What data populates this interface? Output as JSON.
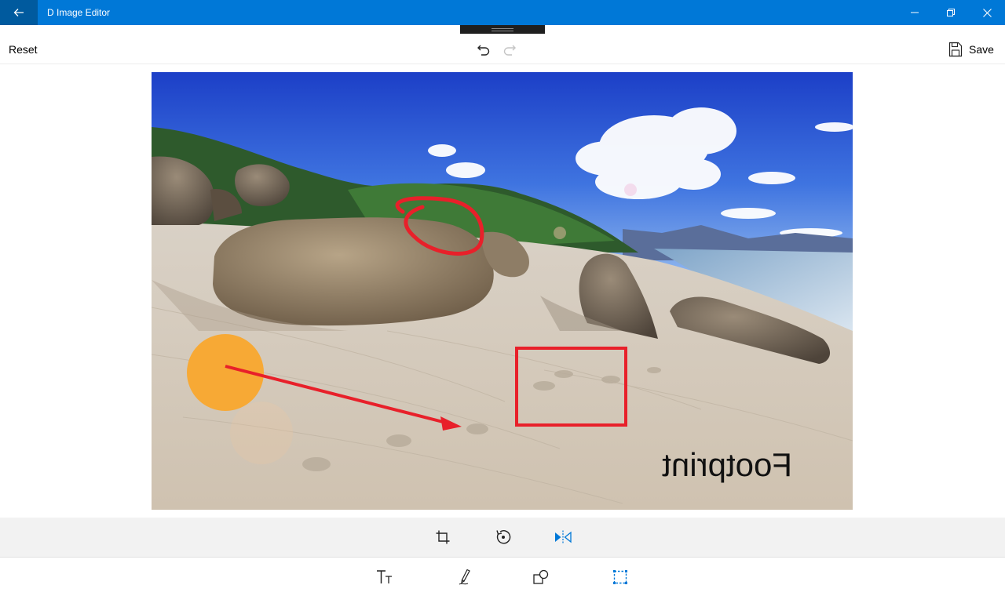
{
  "app": {
    "title": "D Image Editor"
  },
  "commandbar": {
    "reset_label": "Reset",
    "save_label": "Save"
  },
  "image": {
    "annotation_text": "Footprint",
    "colors": {
      "annotation_red": "#e8202a",
      "circle_orange": "#f7a935"
    }
  },
  "icons": {
    "back": "back-arrow-icon",
    "minimize": "minimize-icon",
    "restore": "restore-icon",
    "close": "close-icon",
    "undo": "undo-icon",
    "redo": "redo-icon",
    "save": "save-icon",
    "crop": "crop-icon",
    "rotate": "rotate-icon",
    "flip": "flip-horizontal-icon",
    "text": "text-tool-icon",
    "draw": "pen-tool-icon",
    "shapes": "shapes-tool-icon",
    "select": "selection-tool-icon"
  },
  "theme": {
    "accent": "#0078d7",
    "accent_dark": "#005a9e"
  }
}
